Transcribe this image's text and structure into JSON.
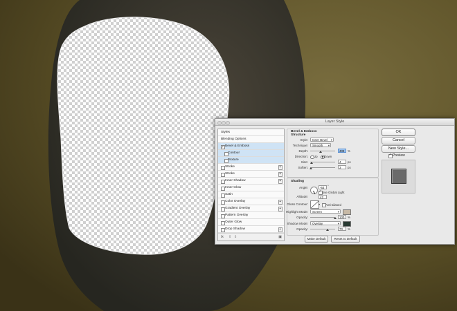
{
  "dialog": {
    "title": "Layer Style"
  },
  "styles_list": {
    "items": [
      {
        "label": "Styles",
        "kind": "hdr"
      },
      {
        "label": "Blending Options",
        "kind": "plain"
      },
      {
        "label": "Bevel & Emboss",
        "kind": "main",
        "checked": true,
        "selected": true
      },
      {
        "label": "Contour",
        "kind": "sub",
        "checked": false,
        "selected": true
      },
      {
        "label": "Texture",
        "kind": "sub",
        "checked": false,
        "selected": true
      },
      {
        "label": "Stroke",
        "kind": "main",
        "checked": false,
        "plus": true
      },
      {
        "label": "Stroke",
        "kind": "main",
        "checked": false,
        "plus": true
      },
      {
        "label": "Inner Shadow",
        "kind": "main",
        "checked": false,
        "plus": true
      },
      {
        "label": "Inner Glow",
        "kind": "main",
        "checked": false
      },
      {
        "label": "Satin",
        "kind": "main",
        "checked": false
      },
      {
        "label": "Color Overlay",
        "kind": "main",
        "checked": false,
        "plus": true
      },
      {
        "label": "Gradient Overlay",
        "kind": "main",
        "checked": false,
        "plus": true
      },
      {
        "label": "Pattern Overlay",
        "kind": "main",
        "checked": false
      },
      {
        "label": "Outer Glow",
        "kind": "main",
        "checked": false
      },
      {
        "label": "Drop Shadow",
        "kind": "main",
        "checked": false,
        "plus": true
      }
    ],
    "footer_icons": [
      "fx-icon",
      "move-up-icon",
      "move-down-icon",
      "trash-icon"
    ]
  },
  "bevel": {
    "section_title": "Bevel & Emboss",
    "structure_title": "Structure",
    "style_label": "Style:",
    "style_value": "Inner Bevel",
    "technique_label": "Technique:",
    "technique_value": "Smooth",
    "depth_label": "Depth:",
    "depth_value": "408",
    "depth_unit": "%",
    "depth_slider": 0.41,
    "direction_label": "Direction:",
    "dir_up": "Up",
    "dir_down": "Down",
    "direction_selected": "Down",
    "size_label": "Size:",
    "size_value": "4",
    "size_unit": "px",
    "size_slider": 0.05,
    "soften_label": "Soften:",
    "soften_value": "3",
    "soften_unit": "px",
    "soften_slider": 0.04
  },
  "shading": {
    "title": "Shading",
    "angle_label": "Angle:",
    "angle_value": "-63",
    "angle_unit": "°",
    "global_light_label": "Use Global Light",
    "global_light": true,
    "altitude_label": "Altitude:",
    "altitude_value": "42",
    "gloss_label": "Gloss Contour:",
    "anti_aliased_label": "Anti-aliased",
    "anti_aliased": false,
    "highlight_label": "Highlight Mode:",
    "highlight_mode": "Screen",
    "highlight_color": "#c7b9a6",
    "h_opacity_label": "Opacity:",
    "h_opacity_value": "100",
    "h_opacity_unit": "%",
    "h_opacity_slider": 1.0,
    "shadow_label": "Shadow Mode:",
    "shadow_mode": "Overlay",
    "shadow_color": "#293a33",
    "s_opacity_label": "Opacity:",
    "s_opacity_value": "70",
    "s_opacity_unit": "%",
    "s_opacity_slider": 0.7
  },
  "bottom_buttons": {
    "make_default": "Make Default",
    "reset_default": "Reset to Default"
  },
  "actions": {
    "ok": "OK",
    "cancel": "Cancel",
    "new_style": "New Style...",
    "preview_label": "Preview",
    "preview": true
  },
  "colors": {
    "background": "#4d4222",
    "accent": "#3b80d6",
    "selected_row": "#cfe3f5"
  }
}
